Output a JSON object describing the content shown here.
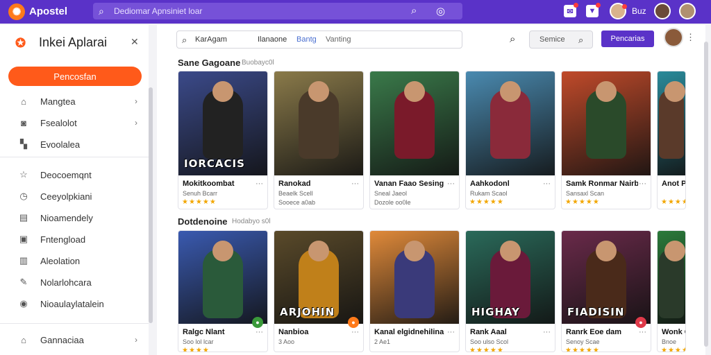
{
  "topbar": {
    "logo_glyph": "✺",
    "title": "Apostel",
    "search_text": "Dediomar Apnsiniet loar",
    "user_label": "Buz"
  },
  "sidebar": {
    "title": "Inkei Aplarai",
    "primary_button": "Pencosfan",
    "items": [
      {
        "label": "Mangtea",
        "icon": "home-icon",
        "chevron": true
      },
      {
        "label": "Fsealolot",
        "icon": "camera-icon",
        "chevron": true
      },
      {
        "label": "Evoolalea",
        "icon": "chart-icon",
        "chevron": false
      },
      {
        "label": "Deocoemqnt",
        "icon": "star-icon",
        "chevron": false
      },
      {
        "label": "Ceeyolpkiani",
        "icon": "clock-icon",
        "chevron": false
      },
      {
        "label": "Nioamendely",
        "icon": "folder-icon",
        "chevron": false
      },
      {
        "label": "Fntengload",
        "icon": "download-icon",
        "chevron": false
      },
      {
        "label": "Aleolation",
        "icon": "library-icon",
        "chevron": false
      },
      {
        "label": "Nolarlohcara",
        "icon": "tag-icon",
        "chevron": false
      },
      {
        "label": "Nioaulaylatalein",
        "icon": "settings-icon",
        "chevron": false
      }
    ],
    "bottom_item": "Gannaciaa"
  },
  "main": {
    "search": {
      "t1": "KarAgam",
      "t2": "Ilanaone",
      "t3": "Bantg",
      "t4": "Vanting"
    },
    "filter_label": "Semice",
    "action_label": "Pencarias",
    "sections": [
      {
        "title": "Sane Gagoane",
        "subtitle": "Buobayc0l"
      },
      {
        "title": "Dotdenoine",
        "subtitle": "Hodabyo s0l"
      }
    ],
    "row1": [
      {
        "name": "Mokitkoombat",
        "meta": "Senuh Bcarr",
        "meta2": "",
        "stars": "★★★★★",
        "art_title": "IORCACIS",
        "bg": "#3b4a8a",
        "fig": "#222"
      },
      {
        "name": "Ranokad",
        "meta": "Beaelk Scell",
        "meta2": "Sooece a0ab",
        "stars": "",
        "art_title": "",
        "bg": "#8a7a4a",
        "fig": "#4a3a2a"
      },
      {
        "name": "Vanan Faao Sesing",
        "meta": "Sneal Jaeol",
        "meta2": "Dozole oo0le",
        "stars": "",
        "art_title": "",
        "bg": "#3a7a4a",
        "fig": "#7a1a2a"
      },
      {
        "name": "Aahkodonl",
        "meta": "Rukam Scaol",
        "meta2": "",
        "stars": "★★★★★",
        "art_title": "",
        "bg": "#4a8ab0",
        "fig": "#8a2a3a"
      },
      {
        "name": "Samk Ronmar Nairb",
        "meta": "Sansaxl Scan",
        "meta2": "",
        "stars": "★★★★★",
        "art_title": "",
        "bg": "#c04a2a",
        "fig": "#2a4a2a"
      },
      {
        "name": "Anot Pa",
        "meta": "",
        "meta2": "",
        "stars": "★★★★",
        "art_title": "",
        "bg": "#2a8a9a",
        "fig": "#5a3a2a"
      }
    ],
    "row2": [
      {
        "name": "Ralgc Nlant",
        "meta": "Soo lol lcar",
        "stars": "★★★★",
        "art_title": "",
        "bg": "#3a5ab0",
        "fig": "#2a5a3a",
        "badge": "#3a9a3a"
      },
      {
        "name": "Nanbioa",
        "meta": "3 Aoo",
        "stars": "",
        "art_title": "ARJOHIN",
        "bg": "#5a4a2a",
        "fig": "#c0801a",
        "badge": "#ff7a1a"
      },
      {
        "name": "Kanal elgidnehilina",
        "meta": "2 Ae1",
        "stars": "",
        "art_title": "",
        "bg": "#e08a3a",
        "fig": "#3a3a7a",
        "badge": ""
      },
      {
        "name": "Rank Aaal",
        "meta": "Soo ulso Scol",
        "stars": "★★★★★",
        "art_title": "HIGHAY",
        "bg": "#2a6a5a",
        "fig": "#6a1a3a",
        "badge": ""
      },
      {
        "name": "Ranrk Eoe dam",
        "meta": "Senoy Scae",
        "stars": "★★★★★",
        "art_title": "FIADISIN",
        "bg": "#6a2a4a",
        "fig": "#4a2a1a",
        "badge": "#e03a4a"
      },
      {
        "name": "Wonk C",
        "meta": "Bnoe",
        "stars": "★★★★",
        "art_title": "",
        "bg": "#2a7a3a",
        "fig": "#2a3a2a",
        "badge": ""
      }
    ]
  }
}
